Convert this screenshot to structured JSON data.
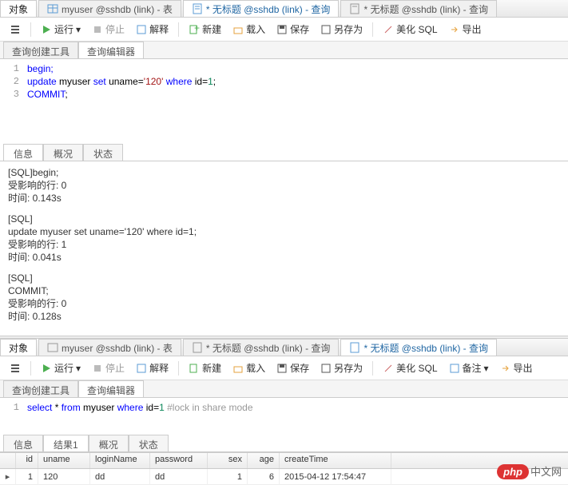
{
  "topPane": {
    "tabs": [
      {
        "label": "对象"
      },
      {
        "label": "myuser @sshdb (link) - 表",
        "icon": "table"
      },
      {
        "label": "* 无标题 @sshdb (link) - 查询",
        "icon": "query",
        "active": true
      },
      {
        "label": "* 无标题 @sshdb (link) - 查询",
        "icon": "query"
      }
    ],
    "toolbar": {
      "run": "运行",
      "stop": "停止",
      "explain": "解释",
      "new": "新建",
      "load": "载入",
      "save": "保存",
      "saveAs": "另存为",
      "beautify": "美化 SQL",
      "export": "导出"
    },
    "subTabs": {
      "builder": "查询创建工具",
      "editor": "查询编辑器"
    },
    "code": {
      "l1": {
        "n": "1",
        "t": "begin;"
      },
      "l2": {
        "n": "2",
        "kw1": "update",
        "t1": " myuser ",
        "kw2": "set",
        "t2": " uname=",
        "str": "'120'",
        "kw3": " where",
        "t3": " id=",
        "num": "1",
        "t4": ";"
      },
      "l3": {
        "n": "3",
        "kw": "COMMIT",
        "t": ";"
      }
    },
    "msgTabs": {
      "info": "信息",
      "profile": "概况",
      "status": "状态"
    },
    "messages": {
      "b1": {
        "l1": "[SQL]begin;",
        "l2": "受影响的行: 0",
        "l3": "时间: 0.143s"
      },
      "b2": {
        "l1": "[SQL]",
        "l2": "update myuser set uname='120' where id=1;",
        "l3": "受影响的行: 1",
        "l4": "时间: 0.041s"
      },
      "b3": {
        "l1": "[SQL]",
        "l2": "COMMIT;",
        "l3": "受影响的行: 0",
        "l4": "时间: 0.128s"
      }
    }
  },
  "bottomPane": {
    "tabs": [
      {
        "label": "对象"
      },
      {
        "label": "myuser @sshdb (link) - 表",
        "icon": "table"
      },
      {
        "label": "* 无标题 @sshdb (link) - 查询",
        "icon": "query"
      },
      {
        "label": "* 无标题 @sshdb (link) - 查询",
        "icon": "query",
        "active": true
      }
    ],
    "toolbar": {
      "run": "运行",
      "stop": "停止",
      "explain": "解释",
      "new": "新建",
      "load": "载入",
      "save": "保存",
      "saveAs": "另存为",
      "beautify": "美化 SQL",
      "notes": "备注",
      "export": "导出"
    },
    "subTabs": {
      "builder": "查询创建工具",
      "editor": "查询编辑器"
    },
    "code": {
      "l1": {
        "n": "1",
        "kw1": "select",
        "t1": " * ",
        "kw2": "from",
        "t2": " myuser ",
        "kw3": "where",
        "t3": " id=",
        "num": "1",
        "cmt": " #lock in share mode"
      }
    },
    "resultTabs": {
      "info": "信息",
      "result1": "结果1",
      "profile": "概况",
      "status": "状态"
    },
    "grid": {
      "headers": {
        "id": "id",
        "uname": "uname",
        "login": "loginName",
        "pw": "password",
        "sex": "sex",
        "age": "age",
        "ct": "createTime"
      },
      "row": {
        "id": "1",
        "uname": "120",
        "login": "dd",
        "pw": "dd",
        "sex": "1",
        "age": "6",
        "ct": "2015-04-12 17:54:47"
      }
    }
  },
  "watermark": {
    "badge": "php",
    "text": "中文网"
  }
}
